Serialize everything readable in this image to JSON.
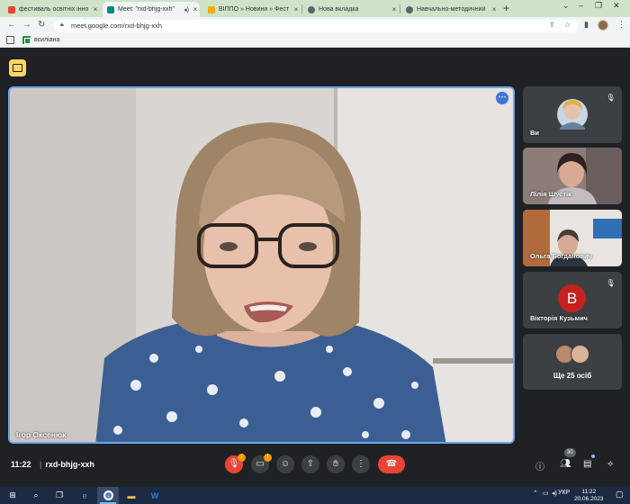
{
  "browser": {
    "tabs": [
      {
        "title": "фестиваль освітніх інно",
        "favicon_color": "#ea4335",
        "active": false
      },
      {
        "title": "Meet: \"rxd-bhjg-xxh\"",
        "favicon_color": "#00897b",
        "active": true
      },
      {
        "title": "ВІППО » Новини » Фест",
        "favicon_color": "#f9ab00",
        "active": false
      },
      {
        "title": "Нова вкладка",
        "favicon_color": "#5f6368",
        "active": false
      },
      {
        "title": "Навчально-методичний",
        "favicon_color": "#5f6368",
        "active": false
      }
    ],
    "new_tab_label": "+",
    "address_url": "meet.google.com/rxd-bhjg-xxh",
    "bookmarks": [
      {
        "label": "всиліана"
      }
    ]
  },
  "meet": {
    "main_speaker": {
      "name": "Ігор Оксенюк"
    },
    "participants": [
      {
        "name": "Ви",
        "muted": true,
        "kind": "video"
      },
      {
        "name": "Лілія Шустік",
        "muted": false,
        "kind": "video"
      },
      {
        "name": "Ольга Богданович",
        "muted": false,
        "kind": "video"
      },
      {
        "name": "Вікторія Кузьмич",
        "muted": true,
        "kind": "avatar",
        "initial": "B"
      }
    ],
    "more_participants_label": "Ще 25 осіб",
    "time": "11:22",
    "meeting_code": "rxd-bhjg-xxh",
    "participant_count": "30",
    "warning_badge": "!",
    "accent_color": "#6fa4ef",
    "hangup_color": "#ea4335"
  },
  "taskbar": {
    "language": "УКР",
    "time": "11:22",
    "date": "20.06.2023"
  }
}
